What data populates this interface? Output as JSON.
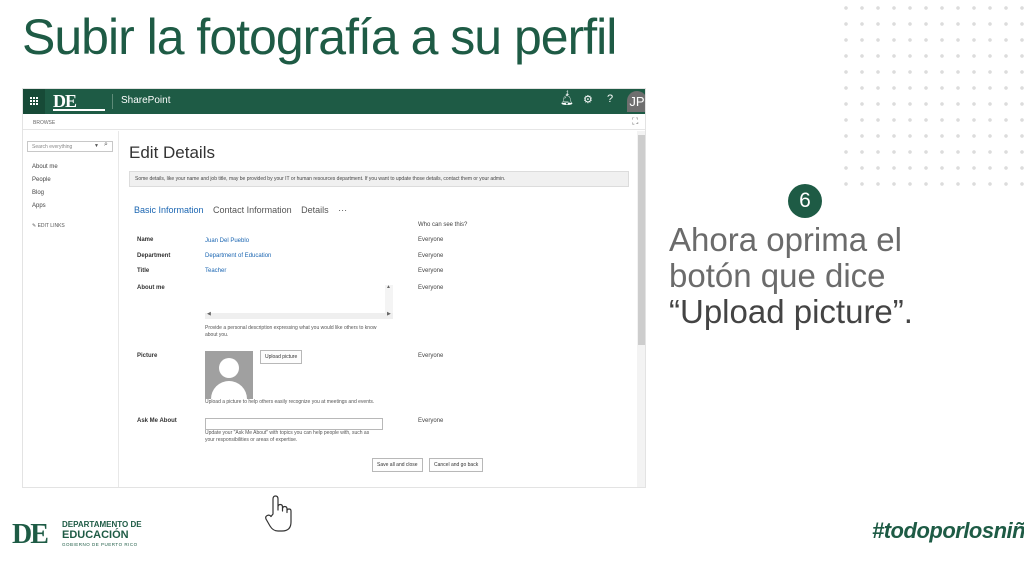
{
  "slide": {
    "title": "Subir la fotografía a su perfil",
    "step_number": "6",
    "instruction_line1": "Ahora oprima el",
    "instruction_line2": "botón que dice",
    "instruction_line3": "“Upload picture”.",
    "brand_color": "#1e5b45",
    "hashtag": "#todoporlosniños"
  },
  "footer_logo": {
    "mark": "DE",
    "line1": "DEPARTAMENTO DE",
    "line2": "EDUCACIÓN",
    "line3": "GOBIERNO DE PUERTO RICO"
  },
  "sharepoint": {
    "topbar": {
      "logo": "DE",
      "app_name": "SharePoint",
      "notification_count": "1",
      "settings_icon": "gear-icon",
      "help_label": "?",
      "avatar_initials": "JP"
    },
    "ribbon": {
      "browse_label": "BROWSE"
    },
    "search": {
      "placeholder": "Search everything"
    },
    "left_nav": {
      "items": [
        "About me",
        "People",
        "Blog",
        "Apps"
      ],
      "edit_links_label": "EDIT LINKS"
    },
    "page": {
      "heading": "Edit Details",
      "notice": "Some details, like your name and job title, may be provided by your IT or human resources department. If you want to update those details, contact them or your admin.",
      "tabs": [
        "Basic Information",
        "Contact Information",
        "Details",
        "···"
      ],
      "who_can_see_header": "Who can see this?",
      "fields": {
        "name": {
          "label": "Name",
          "value": "Juan Del Pueblo",
          "visibility": "Everyone"
        },
        "department": {
          "label": "Department",
          "value": "Department of Education",
          "visibility": "Everyone"
        },
        "title": {
          "label": "Title",
          "value": "Teacher",
          "visibility": "Everyone"
        },
        "about_me": {
          "label": "About me",
          "visibility": "Everyone",
          "hint_line1": "Provide a personal description expressing what you would like others to know",
          "hint_line2": "about you."
        },
        "picture": {
          "label": "Picture",
          "visibility": "Everyone",
          "upload_button": "Upload picture",
          "hint": "Upload a picture to help others easily recognize you at meetings and events."
        },
        "ask_me_about": {
          "label": "Ask Me About",
          "visibility": "Everyone",
          "hint_line1": "Update your \"Ask Me About\" with topics you can help people with, such as",
          "hint_line2": "your responsibilities or areas of expertise."
        }
      },
      "save_button": "Save all and close",
      "cancel_button": "Cancel and go back"
    }
  }
}
